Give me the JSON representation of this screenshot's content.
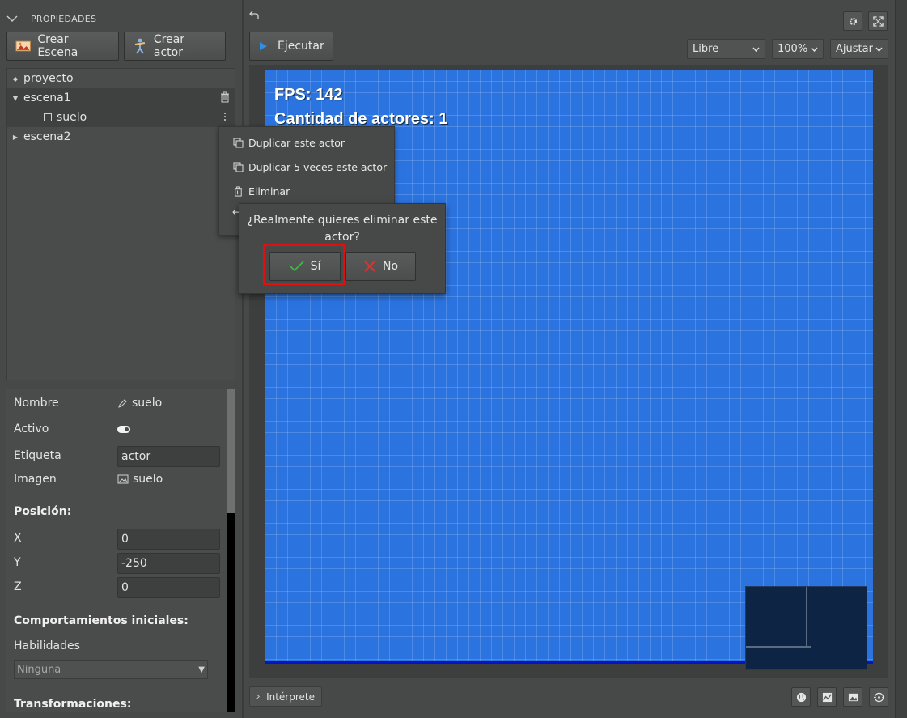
{
  "left_panel": {
    "header": "PROPIEDADES",
    "buttons": {
      "crear_escena": "Crear Escena",
      "crear_actor": "Crear actor"
    },
    "tree": {
      "root": "proyecto",
      "scene1": "escena1",
      "actor": "suelo",
      "scene2": "escena2"
    },
    "properties": {
      "nombre_label": "Nombre",
      "nombre_value": "suelo",
      "activo_label": "Activo",
      "etiqueta_label": "Etiqueta",
      "etiqueta_value": "actor",
      "imagen_label": "Imagen",
      "imagen_value": "suelo",
      "posicion_title": "Posición:",
      "x_label": "X",
      "x_value": "0",
      "y_label": "Y",
      "y_value": "-250",
      "z_label": "Z",
      "z_value": "0",
      "comportamientos_title": "Comportamientos iniciales:",
      "habilidades_label": "Habilidades",
      "habilidades_value": "Ninguna",
      "transformaciones_title": "Transformaciones:"
    }
  },
  "toolbar": {
    "ejecutar": "Ejecutar",
    "mode": "Libre",
    "zoom": "100%",
    "fit": "Ajustar"
  },
  "stage": {
    "fps": "FPS: 142",
    "actors": "Cantidad de actores: 1"
  },
  "context_menu": {
    "duplicate": "Duplicar este actor",
    "duplicate5": "Duplicar 5 veces este actor",
    "delete": "Eliminar"
  },
  "dialog": {
    "message": "¿Realmente quieres eliminar este actor?",
    "yes": "Sí",
    "no": "No"
  },
  "bottom": {
    "interprete": "Intérprete"
  },
  "colors": {
    "stage_bg": "#2b74e0",
    "highlight": "#e01010",
    "play": "#2f8fe8",
    "yes_check": "#3cbf3c",
    "no_x": "#e03030"
  }
}
